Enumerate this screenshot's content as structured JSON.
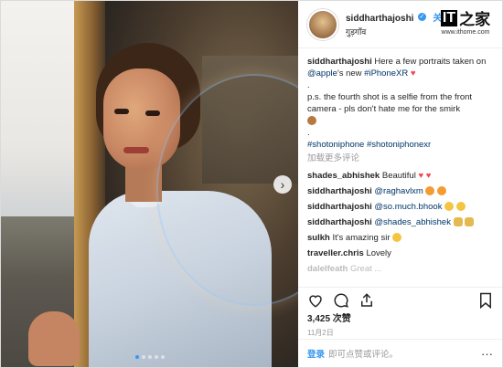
{
  "post": {
    "username": "siddharthajoshi",
    "follow_label": "关",
    "location": "गुड़गाँव",
    "caption_user": "siddharthajoshi",
    "caption_line1": "Here a few portraits taken on",
    "caption_mention": "@apple",
    "caption_line2": "'s new",
    "caption_hashtag": "#iPhoneXR",
    "caption_dot": ".",
    "caption_ps": "p.s. the fourth shot is a selfie from the front camera - pls don't hate me for the smirk",
    "caption_tags": "#shotoniphone #shotoniphonexr",
    "load_more": "加载更多评论",
    "likes": "3,425 次赞",
    "date": "11月2日",
    "login": "登录",
    "login_suffix": "即可点赞或评论。"
  },
  "comments": [
    {
      "user": "shades_abhishek",
      "text": "Beautiful",
      "emoji": [
        "heart",
        "heart"
      ]
    },
    {
      "user": "siddharthajoshi",
      "text": "@raghavlxm",
      "emoji": [
        "fire",
        "fire"
      ]
    },
    {
      "user": "siddharthajoshi",
      "text": "@so.much.bhook",
      "emoji": [
        "tear",
        "tear"
      ]
    },
    {
      "user": "siddharthajoshi",
      "text": "@shades_abhishek",
      "emoji": [
        "pray",
        "pray"
      ]
    },
    {
      "user": "sulkh",
      "text": "It's amazing sir",
      "emoji": [
        "smile"
      ]
    },
    {
      "user": "traveller.chris",
      "text": "Lovely",
      "emoji": []
    },
    {
      "user": "dalelfeath",
      "text": "Great ...",
      "emoji": []
    }
  ],
  "watermark": {
    "logo_it": "IT",
    "logo_glyph": "之家",
    "url": "www.ithome.com"
  },
  "icons": [
    "next-arrow-icon",
    "verified-badge-icon",
    "heart-outline-icon",
    "comment-icon",
    "share-icon",
    "bookmark-icon",
    "more-icon"
  ],
  "carousel": {
    "slides": 5,
    "active": 1
  },
  "colors": {
    "accent": "#3897f0",
    "text": "#262626",
    "muted": "#999999"
  }
}
